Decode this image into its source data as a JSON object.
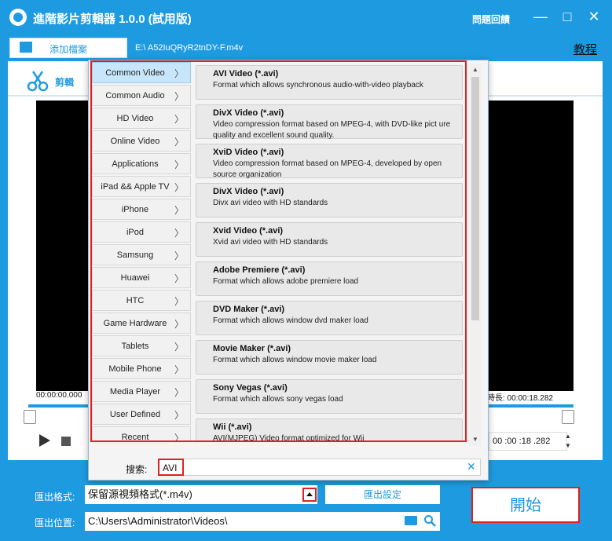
{
  "app": {
    "title": "進階影片剪輯器 1.0.0 (試用版)",
    "help": "問題回饋"
  },
  "window_controls": {
    "minimize": "—",
    "maximize": "□",
    "close": "✕"
  },
  "toolbar": {
    "add_file": "添加檔案",
    "file_path": "E:\\          A52IuQRyR2tnDY-F.m4v",
    "tutorial": "教程"
  },
  "tabs": [
    {
      "label": "剪輯",
      "icon": "scissors-icon"
    }
  ],
  "player": {
    "time_start": "00:00:00.000",
    "duration": "時長:  00:00:18.282",
    "time_field": "00 :00 :18 .282"
  },
  "categories": [
    {
      "label": "Common Video",
      "selected": true
    },
    {
      "label": "Common Audio"
    },
    {
      "label": "HD Video"
    },
    {
      "label": "Online Video"
    },
    {
      "label": "Applications"
    },
    {
      "label": "iPad && Apple TV"
    },
    {
      "label": "iPhone"
    },
    {
      "label": "iPod"
    },
    {
      "label": "Samsung"
    },
    {
      "label": "Huawei"
    },
    {
      "label": "HTC"
    },
    {
      "label": "Game Hardware"
    },
    {
      "label": "Tablets"
    },
    {
      "label": "Mobile Phone"
    },
    {
      "label": "Media Player"
    },
    {
      "label": "User Defined"
    },
    {
      "label": "Recent"
    }
  ],
  "formats": [
    {
      "title": "AVI Video (*.avi)",
      "desc": "Format which allows synchronous audio-with-video playback"
    },
    {
      "title": "DivX Video (*.avi)",
      "desc": "Video compression format based on MPEG-4, with DVD-like pict ure quality and excellent sound quality."
    },
    {
      "title": "XviD Video (*.avi)",
      "desc": "Video compression format based on MPEG-4, developed by open source organization"
    },
    {
      "title": "DivX Video (*.avi)",
      "desc": "Divx avi video with HD standards"
    },
    {
      "title": "Xvid Video (*.avi)",
      "desc": "Xvid avi video with HD standards"
    },
    {
      "title": "Adobe Premiere (*.avi)",
      "desc": "Format which allows adobe premiere load"
    },
    {
      "title": "DVD Maker (*.avi)",
      "desc": "Format which allows window dvd maker load"
    },
    {
      "title": "Movie Maker (*.avi)",
      "desc": "Format which allows window movie maker load"
    },
    {
      "title": "Sony Vegas (*.avi)",
      "desc": "Format which allows sony vegas load"
    },
    {
      "title": "Wii (*.avi)",
      "desc": "AVI(MJPEG) Video format optimized for Wii"
    }
  ],
  "search": {
    "label": "搜索:",
    "value": "AVI"
  },
  "export": {
    "format_label": "匯出格式:",
    "format_value": "保留源視頻格式(*.m4v)",
    "settings_button": "匯出設定",
    "path_label": "匯出位置:",
    "path_value": "C:\\Users\\Administrator\\Videos\\",
    "start_button": "開始"
  },
  "colors": {
    "accent": "#1e9be0",
    "highlight": "#e02020",
    "selected_category": "#c8e6fb"
  }
}
